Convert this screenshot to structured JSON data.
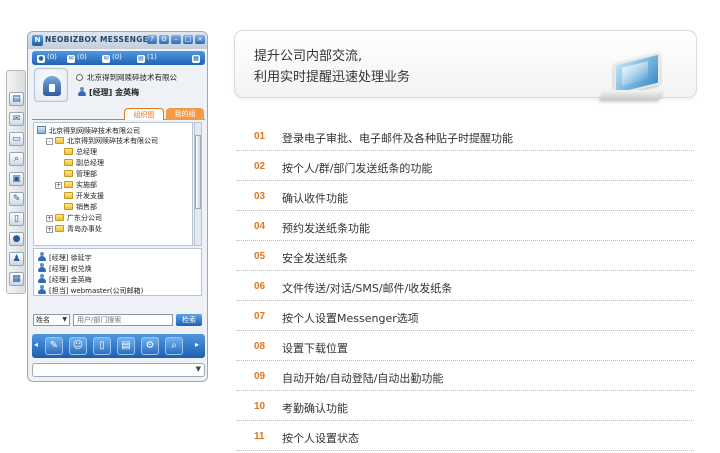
{
  "messenger": {
    "title": "NEOBIZBOX MESSENGER",
    "status_counts": [
      "(0)",
      "(0)",
      "(0)",
      "(1)"
    ],
    "company": "北京得到网赎碎技术有限公",
    "user": "[经理] 金英梅",
    "tabs": {
      "active": "组织图",
      "inactive": "我的组"
    },
    "tree": [
      {
        "label": "北京得到网赎碎技术有限公司",
        "level": 0,
        "toggle": "",
        "icon": "root"
      },
      {
        "label": "北京得到网赎碎技术有限公司",
        "level": 1,
        "toggle": "-",
        "icon": "folder"
      },
      {
        "label": "总经理",
        "level": 2,
        "toggle": "",
        "icon": "folder"
      },
      {
        "label": "副总经理",
        "level": 2,
        "toggle": "",
        "icon": "folder"
      },
      {
        "label": "管理部",
        "level": 2,
        "toggle": "",
        "icon": "folder"
      },
      {
        "label": "实施部",
        "level": 2,
        "toggle": "+",
        "icon": "folder"
      },
      {
        "label": "开发支援",
        "level": 2,
        "toggle": "",
        "icon": "folder"
      },
      {
        "label": "销售部",
        "level": 2,
        "toggle": "",
        "icon": "folder"
      },
      {
        "label": "广东分公司",
        "level": 1,
        "toggle": "+",
        "icon": "folder"
      },
      {
        "label": "青岛办事处",
        "level": 1,
        "toggle": "+",
        "icon": "folder"
      }
    ],
    "people": [
      "[经理] 徐延宇",
      "[经理] 权兑焕",
      "[经理] 金英梅",
      "[担当] webmaster(公司邮箱)"
    ],
    "search": {
      "select_label": "姓名",
      "placeholder": "用户/部门搜索",
      "button": "检索"
    }
  },
  "banner": {
    "line1": "提升公司内部交流,",
    "line2": "利用实时提醒迅速处理业务"
  },
  "features": [
    {
      "num": "01",
      "text": "登录电子审批、电子邮件及各种贴子时提醒功能"
    },
    {
      "num": "02",
      "text": "按个人/群/部门发送纸条的功能"
    },
    {
      "num": "03",
      "text": "确认收件功能"
    },
    {
      "num": "04",
      "text": "预约发送纸条功能"
    },
    {
      "num": "05",
      "text": "安全发送纸条"
    },
    {
      "num": "06",
      "text": "文件传送/对话/SMS/邮件/收发纸条"
    },
    {
      "num": "07",
      "text": "按个人设置Messenger选项"
    },
    {
      "num": "08",
      "text": "设置下载位置"
    },
    {
      "num": "09",
      "text": "自动开始/自动登陆/自动出勤功能"
    },
    {
      "num": "10",
      "text": "考勤确认功能"
    },
    {
      "num": "11",
      "text": "按个人设置状态"
    }
  ],
  "colors": {
    "accent": "#e0761e",
    "blue": "#1e63b5"
  }
}
